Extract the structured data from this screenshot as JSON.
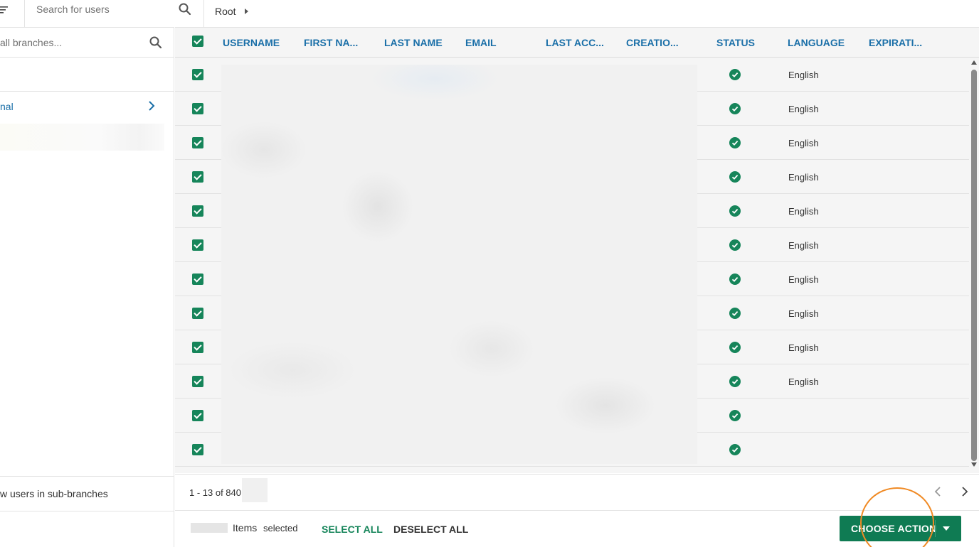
{
  "topbar": {
    "user_search_placeholder": "Search for users",
    "breadcrumb_root": "Root"
  },
  "sidebar": {
    "branch_search_placeholder": "all branches...",
    "branch_item_label": "nal",
    "subbranches_label": "w users in sub-branches"
  },
  "table": {
    "columns": [
      "USERNAME",
      "FIRST NA...",
      "LAST NAME",
      "EMAIL",
      "LAST ACC...",
      "CREATIO...",
      "STATUS",
      "LANGUAGE",
      "EXPIRATI..."
    ],
    "rows": [
      {
        "language": "English"
      },
      {
        "language": "English"
      },
      {
        "language": "English"
      },
      {
        "language": "English"
      },
      {
        "language": "English"
      },
      {
        "language": "English"
      },
      {
        "language": "English"
      },
      {
        "language": "English"
      },
      {
        "language": "English"
      },
      {
        "language": "English"
      },
      {
        "language": ""
      },
      {
        "language": ""
      }
    ]
  },
  "pager": {
    "range_text": "1 - 13 of 840"
  },
  "actions": {
    "items_word": "Items",
    "selected_word": "selected",
    "select_all": "SELECT ALL",
    "deselect_all": "DESELECT ALL",
    "choose_action": "CHOOSE ACTION"
  },
  "colors": {
    "accent_green": "#0f7b53",
    "link_blue": "#1a6fa8",
    "highlight_orange": "#f08a24"
  }
}
